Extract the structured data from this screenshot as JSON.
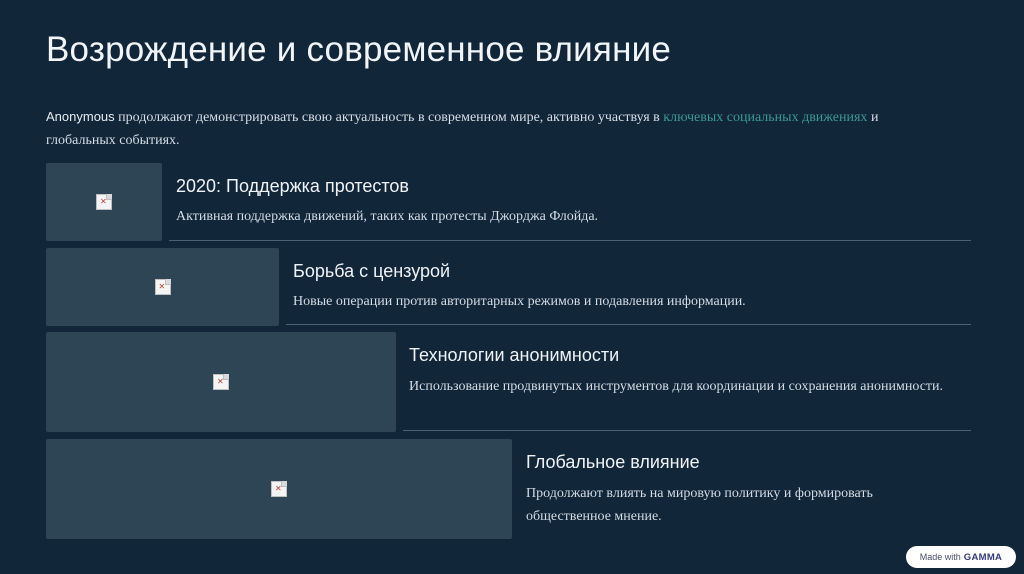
{
  "title": "Возрождение и современное влияние",
  "intro": {
    "brand": "Anonymous",
    "before_link": " продолжают демонстрировать свою актуальность в современном мире, активно участвуя в ",
    "link": "ключевых социальных движениях",
    "after_link": " и глобальных событиях."
  },
  "items": [
    {
      "title": "2020: Поддержка протестов",
      "description": "Активная поддержка движений, таких как протесты Джорджа Флойда."
    },
    {
      "title": "Борьба с цензурой",
      "description": "Новые операции против авторитарных режимов и подавления информации."
    },
    {
      "title": "Технологии анонимности",
      "description": "Использование продвинутых инструментов для координации и сохранения анонимности."
    },
    {
      "title": "Глобальное влияние",
      "description": "Продолжают влиять на мировую политику и формировать общественное мнение."
    }
  ],
  "badge": {
    "prefix": "Made with",
    "brand": "GAMMA"
  },
  "colors": {
    "background": "#12263a",
    "accent_link": "#3a9a91",
    "image_placeholder": "#2e4555"
  },
  "icons": {
    "image_placeholder": "broken-image-icon"
  }
}
